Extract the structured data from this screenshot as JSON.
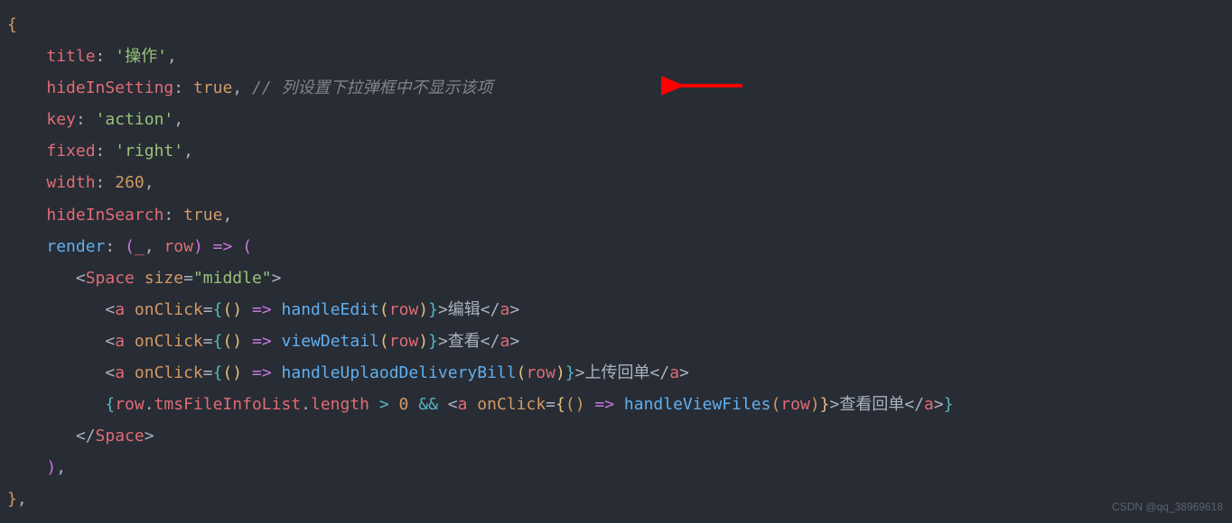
{
  "code": {
    "line1": "{",
    "line2_prop": "title",
    "line2_val": "'操作'",
    "line3_prop": "hideInSetting",
    "line3_val": "true",
    "line3_comment": "// 列设置下拉弹框中不显示该项",
    "line4_prop": "key",
    "line4_val": "'action'",
    "line5_prop": "fixed",
    "line5_val": "'right'",
    "line6_prop": "width",
    "line6_val": "260",
    "line7_prop": "hideInSearch",
    "line7_val": "true",
    "line8_prop": "render",
    "line8_param1": "_",
    "line8_param2": "row",
    "line9_tag": "Space",
    "line9_attr": "size",
    "line9_attrval": "\"middle\"",
    "line10_tag": "a",
    "line10_attr": "onClick",
    "line10_func": "handleEdit",
    "line10_arg": "row",
    "line10_text": "编辑",
    "line11_tag": "a",
    "line11_attr": "onClick",
    "line11_func": "viewDetail",
    "line11_arg": "row",
    "line11_text": "查看",
    "line12_tag": "a",
    "line12_attr": "onClick",
    "line12_func": "handleUplaodDeliveryBill",
    "line12_arg": "row",
    "line12_text": "上传回单",
    "line13_obj": "row",
    "line13_prop1": "tmsFileInfoList",
    "line13_prop2": "length",
    "line13_num": "0",
    "line13_tag": "a",
    "line13_attr": "onClick",
    "line13_func": "handleViewFiles",
    "line13_arg": "row",
    "line13_text": "查看回单",
    "line14_tag": "Space"
  },
  "watermark": "CSDN @qq_38969618"
}
